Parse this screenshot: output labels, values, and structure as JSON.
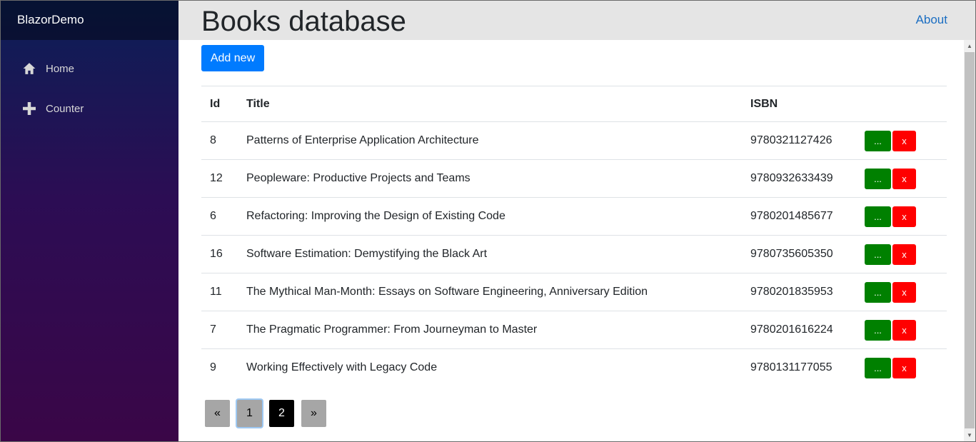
{
  "sidebar": {
    "brand": "BlazorDemo",
    "items": [
      {
        "label": "Home",
        "icon": "home-icon"
      },
      {
        "label": "Counter",
        "icon": "plus-icon"
      }
    ]
  },
  "header": {
    "title": "Books database",
    "about": "About"
  },
  "toolbar": {
    "add_label": "Add new"
  },
  "table": {
    "headers": {
      "id": "Id",
      "title": "Title",
      "isbn": "ISBN"
    },
    "rows": [
      {
        "id": "8",
        "title": "Patterns of Enterprise Application Architecture",
        "isbn": "9780321127426"
      },
      {
        "id": "12",
        "title": "Peopleware: Productive Projects and Teams",
        "isbn": "9780932633439"
      },
      {
        "id": "6",
        "title": "Refactoring: Improving the Design of Existing Code",
        "isbn": "9780201485677"
      },
      {
        "id": "16",
        "title": "Software Estimation: Demystifying the Black Art",
        "isbn": "9780735605350"
      },
      {
        "id": "11",
        "title": "The Mythical Man-Month: Essays on Software Engineering, Anniversary Edition",
        "isbn": "9780201835953"
      },
      {
        "id": "7",
        "title": "The Pragmatic Programmer: From Journeyman to Master",
        "isbn": "9780201616224"
      },
      {
        "id": "9",
        "title": "Working Effectively with Legacy Code",
        "isbn": "9780131177055"
      }
    ],
    "edit_label": "...",
    "delete_label": "x"
  },
  "pagination": {
    "prev": "«",
    "pages": [
      "1",
      "2"
    ],
    "next": "»"
  },
  "colors": {
    "primary": "#007bff",
    "edit": "#008000",
    "delete": "#ff0000",
    "link": "#1b6ec2"
  }
}
